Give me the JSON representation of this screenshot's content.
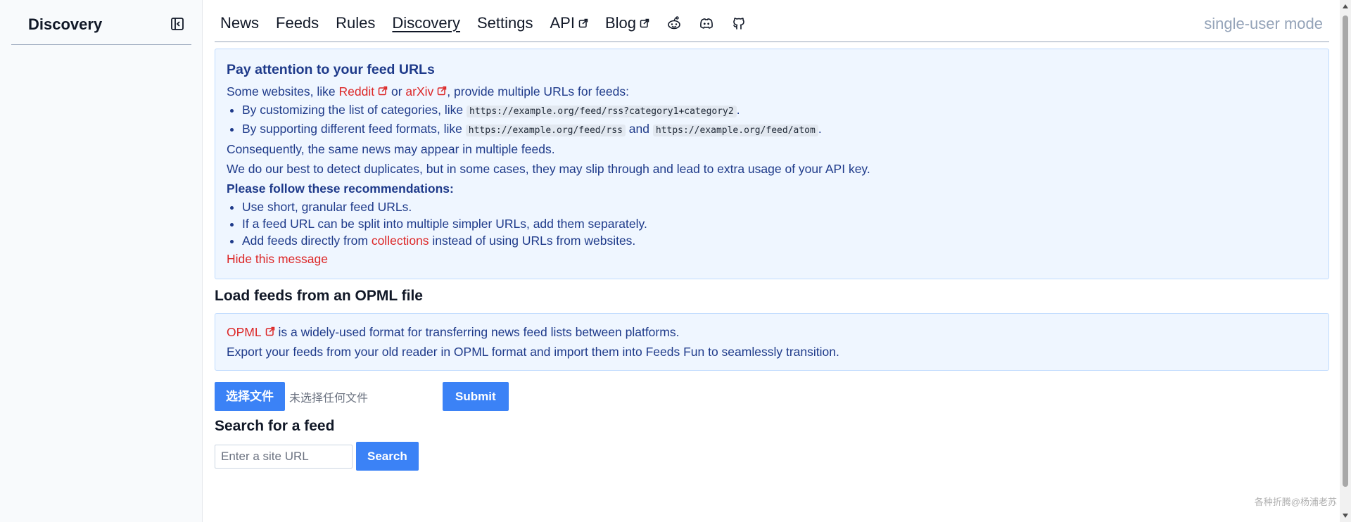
{
  "sidebar": {
    "title": "Discovery",
    "collapse_icon": "sidebar-collapse-icon"
  },
  "nav": {
    "items": [
      {
        "label": "News"
      },
      {
        "label": "Feeds"
      },
      {
        "label": "Rules"
      },
      {
        "label": "Discovery",
        "active": true
      },
      {
        "label": "Settings"
      },
      {
        "label": "API",
        "external": true
      },
      {
        "label": "Blog",
        "external": true
      }
    ],
    "icons": [
      "reddit-icon",
      "discord-icon",
      "github-icon"
    ],
    "mode": "single-user mode"
  },
  "notice": {
    "title": "Pay attention to your feed URLs",
    "intro_prefix": "Some websites, like ",
    "link1": "Reddit",
    "or": " or ",
    "link2": "arXiv",
    "intro_suffix": ", provide multiple URLs for feeds:",
    "bullet1_prefix": "By customizing the list of categories, like ",
    "bullet1_code": "https://example.org/feed/rss?category1+category2",
    "bullet1_suffix": ".",
    "bullet2_prefix": "By supporting different feed formats, like ",
    "bullet2_code1": "https://example.org/feed/rss",
    "bullet2_and": " and ",
    "bullet2_code2": "https://example.org/feed/atom",
    "bullet2_suffix": ".",
    "line_consequently": "Consequently, the same news may appear in multiple feeds.",
    "line_duplicates": "We do our best to detect duplicates, but in some cases, they may slip through and lead to extra usage of your API key.",
    "recommendations_title": "Please follow these recommendations:",
    "rec1": "Use short, granular feed URLs.",
    "rec2": "If a feed URL can be split into multiple simpler URLs, add them separately.",
    "rec3_prefix": "Add feeds directly from ",
    "rec3_link": "collections",
    "rec3_suffix": " instead of using URLs from websites.",
    "hide_link": "Hide this message"
  },
  "opml": {
    "section_title": "Load feeds from an OPML file",
    "link": "OPML",
    "line1_suffix": " is a widely-used format for transferring news feed lists between platforms.",
    "line2": "Export your feeds from your old reader in OPML format and import them into Feeds Fun to seamlessly transition.",
    "choose_file_label": "选择文件",
    "no_file_label": "未选择任何文件",
    "submit_label": "Submit"
  },
  "search": {
    "section_title": "Search for a feed",
    "placeholder": "Enter a site URL",
    "button_label": "Search"
  },
  "watermark": "各种折腾@杨浦老苏",
  "colors": {
    "accent": "#3b82f6",
    "link": "#dc2626",
    "notice_bg": "#eff6ff",
    "notice_text": "#1e3a8a"
  }
}
